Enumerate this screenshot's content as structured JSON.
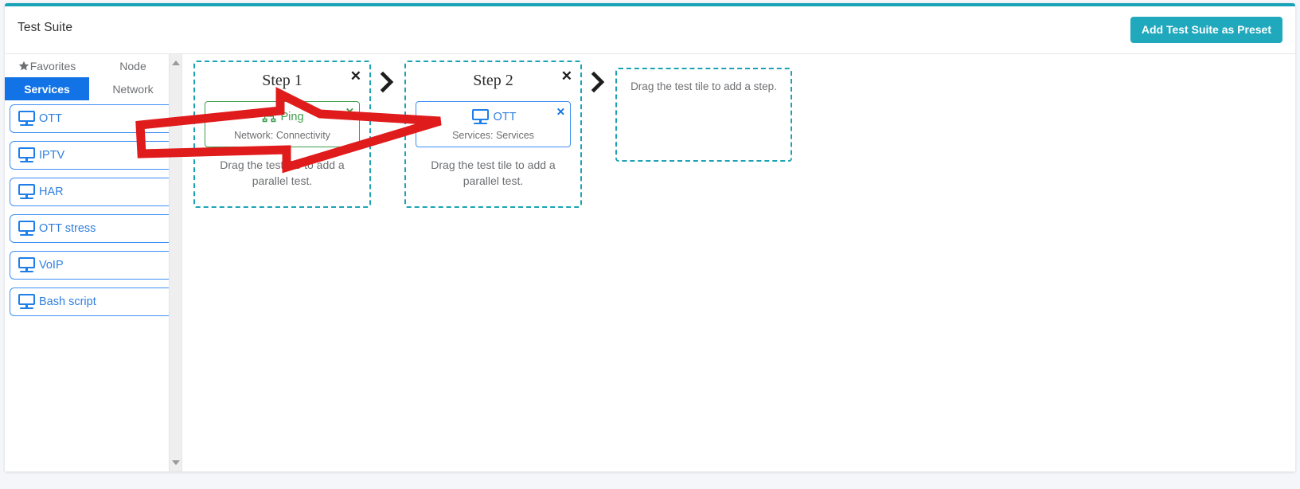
{
  "theme": {
    "accent_teal": "#20a8bd",
    "top_bar_teal": "#17a2b8",
    "tab_active_blue": "#1273e6",
    "tile_blue": "#3d8ff5",
    "tile_green": "#3f9e4d",
    "dashed_teal": "#1ba3b5",
    "annotation_red": "#e01b1b"
  },
  "header": {
    "title": "Test Suite",
    "preset_button_label": "Add Test Suite as Preset"
  },
  "sidebar": {
    "tabs": [
      {
        "label": "Favorites",
        "icon": "star-icon",
        "active": false
      },
      {
        "label": "Node",
        "icon": "",
        "active": false
      },
      {
        "label": "Services",
        "icon": "",
        "active": true
      },
      {
        "label": "Network",
        "icon": "",
        "active": false
      }
    ],
    "tiles": [
      {
        "label": "OTT",
        "icon": "monitor-icon"
      },
      {
        "label": "IPTV",
        "icon": "monitor-icon"
      },
      {
        "label": "HAR",
        "icon": "monitor-icon"
      },
      {
        "label": "OTT stress",
        "icon": "monitor-icon"
      },
      {
        "label": "VoIP",
        "icon": "monitor-icon"
      },
      {
        "label": "Bash script",
        "icon": "monitor-icon"
      }
    ],
    "scrollbar": {
      "up_arrow": "scroll-up-arrow-icon",
      "down_arrow": "scroll-down-arrow-icon"
    }
  },
  "canvas": {
    "steps": [
      {
        "title": "Step 1",
        "close_label": "✕",
        "test": {
          "name": "Ping",
          "subtitle": "Network: Connectivity",
          "icon": "sitemap-icon",
          "color": "green",
          "close_label": "✕"
        },
        "parallel_hint": "Drag the test tile to add a parallel test."
      },
      {
        "title": "Step 2",
        "close_label": "✕",
        "test": {
          "name": "OTT",
          "subtitle": "Services: Services",
          "icon": "monitor-icon",
          "color": "blue",
          "close_label": "✕"
        },
        "parallel_hint": "Drag the test tile to add a parallel test."
      }
    ],
    "step_connector_icon": "chevron-right-icon",
    "add_step_dropzone": {
      "text": "Drag the test tile to add a step."
    }
  },
  "annotation": {
    "type": "block-arrow",
    "color": "#e01b1b",
    "description": "red outlined arrow pointing from OTT sidebar tile to the OTT test tile in Step 2"
  }
}
